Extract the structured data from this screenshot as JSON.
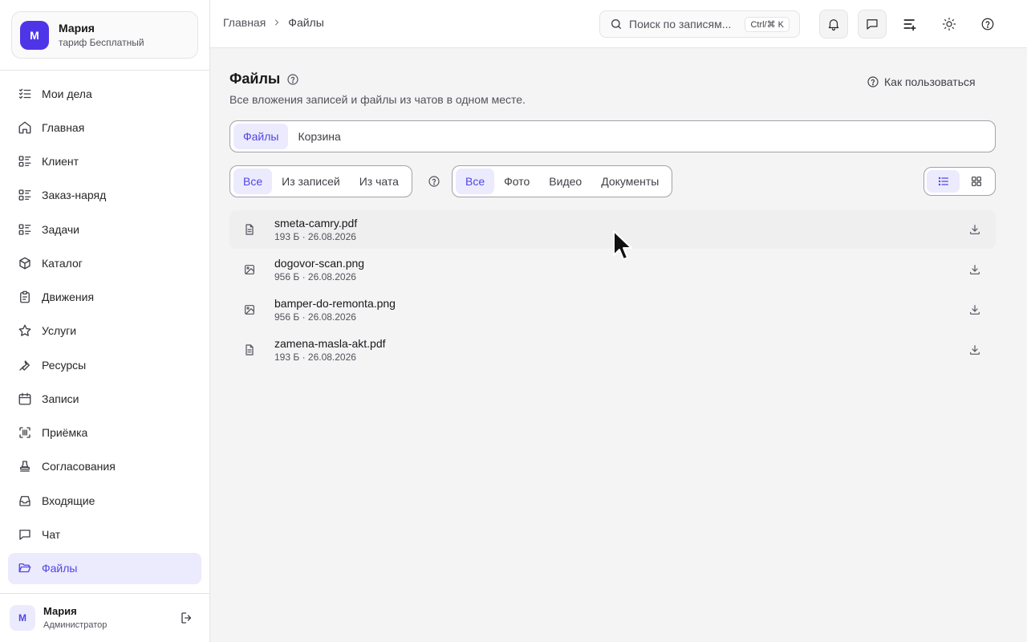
{
  "account": {
    "avatar_letter": "М",
    "name": "Мария",
    "plan": "тариф Бесплатный"
  },
  "sidebar": {
    "items": [
      {
        "label": "Мои дела",
        "icon": "checklist-icon"
      },
      {
        "label": "Главная",
        "icon": "home-icon"
      },
      {
        "label": "Клиент",
        "icon": "list-details-icon"
      },
      {
        "label": "Заказ-наряд",
        "icon": "list-details-icon"
      },
      {
        "label": "Задачи",
        "icon": "list-details-icon"
      },
      {
        "label": "Каталог",
        "icon": "package-icon"
      },
      {
        "label": "Движения",
        "icon": "clipboard-icon"
      },
      {
        "label": "Услуги",
        "icon": "star-icon"
      },
      {
        "label": "Ресурсы",
        "icon": "wrench-icon"
      },
      {
        "label": "Записи",
        "icon": "calendar-icon"
      },
      {
        "label": "Приёмка",
        "icon": "scan-icon"
      },
      {
        "label": "Согласования",
        "icon": "stamp-icon"
      },
      {
        "label": "Входящие",
        "icon": "inbox-icon"
      },
      {
        "label": "Чат",
        "icon": "chat-icon"
      },
      {
        "label": "Файлы",
        "icon": "folder-open-icon",
        "active": true
      }
    ]
  },
  "user": {
    "avatar_letter": "М",
    "name": "Мария",
    "role": "Администратор"
  },
  "header": {
    "breadcrumb": [
      "Главная",
      "Файлы"
    ],
    "search_placeholder": "Поиск по записям...",
    "search_shortcut": "Ctrl/⌘ K"
  },
  "page": {
    "title": "Файлы",
    "subtitle": "Все вложения записей и файлы из чатов в одном месте.",
    "how_to": "Как пользоваться",
    "tabs": [
      "Файлы",
      "Корзина"
    ],
    "source_filter": [
      "Все",
      "Из записей",
      "Из чата"
    ],
    "type_filter": [
      "Все",
      "Фото",
      "Видео",
      "Документы"
    ]
  },
  "files": [
    {
      "name": "smeta-camry.pdf",
      "meta": "193 Б · 26.08.2026",
      "icon": "document-icon"
    },
    {
      "name": "dogovor-scan.png",
      "meta": "956 Б · 26.08.2026",
      "icon": "image-icon"
    },
    {
      "name": "bamper-do-remonta.png",
      "meta": "956 Б · 26.08.2026",
      "icon": "image-icon"
    },
    {
      "name": "zamena-masla-akt.pdf",
      "meta": "193 Б · 26.08.2026",
      "icon": "document-icon"
    }
  ],
  "colors": {
    "accent": "#4f46e5",
    "accent_bg": "#ecebfd",
    "avatar": "#4f35e8"
  }
}
